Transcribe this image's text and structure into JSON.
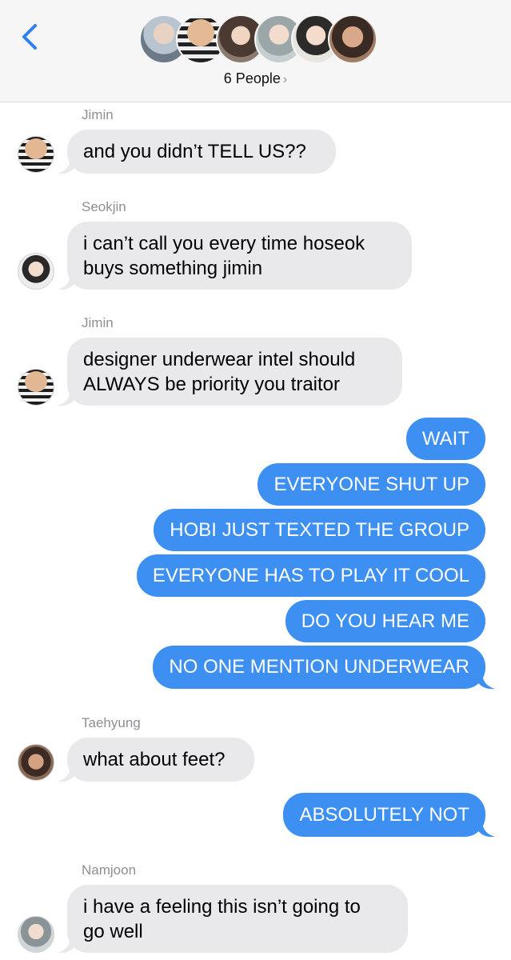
{
  "header": {
    "people_label": "6 People",
    "chevron": "›",
    "avatar_count": 6
  },
  "colors": {
    "accent": "#3d90f1",
    "incoming_bubble": "#e9e9eb",
    "back_arrow": "#2f7ff3"
  },
  "messages": [
    {
      "sender": "Jimin",
      "lines": [
        "and you didn’t TELL US??"
      ]
    },
    {
      "sender": "Seokjin",
      "lines": [
        "i can’t call you every time hoseok",
        "buys something jimin"
      ]
    },
    {
      "sender": "Jimin",
      "lines": [
        "designer underwear intel should",
        "ALWAYS be priority you traitor"
      ]
    },
    {
      "outgoing": [
        "WAIT",
        "EVERYONE SHUT UP",
        "HOBI JUST TEXTED THE GROUP",
        "EVERYONE HAS TO PLAY IT COOL",
        "DO YOU HEAR ME",
        "NO ONE MENTION UNDERWEAR"
      ]
    },
    {
      "sender": "Taehyung",
      "lines": [
        "what about feet?"
      ]
    },
    {
      "outgoing": [
        "ABSOLUTELY NOT"
      ]
    },
    {
      "sender": "Namjoon",
      "lines": [
        "i have a feeling this isn’t going to",
        "go well"
      ]
    }
  ]
}
